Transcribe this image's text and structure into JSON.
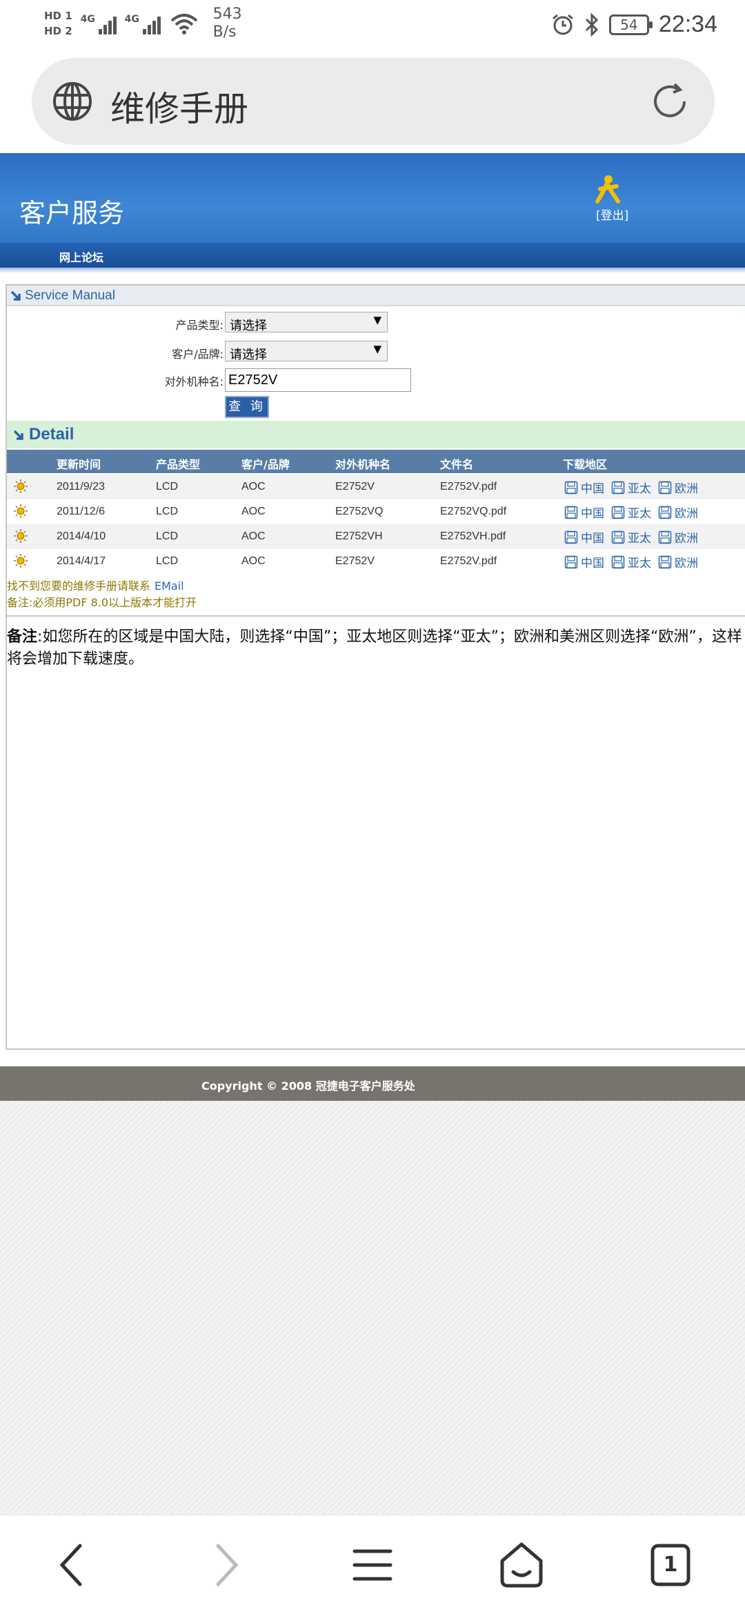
{
  "status_bar": {
    "sim1": "HD 1",
    "sim2": "HD 2",
    "net1": "4G",
    "net2": "4G",
    "speed_value": "543",
    "speed_unit": "B/s",
    "battery": "54",
    "time": "22:34"
  },
  "browser": {
    "page_title": "维修手册"
  },
  "site": {
    "title": "客户服务",
    "logout": "[登出]",
    "nav_forum": "网上论坛"
  },
  "search": {
    "section_title": "Service Manual",
    "product_type_label": "产品类型:",
    "product_type_value": "请选择",
    "brand_label": "客户/品牌:",
    "brand_value": "请选择",
    "model_label": "对外机种名:",
    "model_value": "E2752V",
    "query_button": "查 询"
  },
  "detail": {
    "section_title": "Detail",
    "columns": [
      "更新时间",
      "产品类型",
      "客户/品牌",
      "对外机种名",
      "文件名",
      "下载地区"
    ],
    "rows": [
      {
        "date": "2011/9/23",
        "type": "LCD",
        "brand": "AOC",
        "model": "E2752V",
        "file": "E2752V.pdf"
      },
      {
        "date": "2011/12/6",
        "type": "LCD",
        "brand": "AOC",
        "model": "E2752VQ",
        "file": "E2752VQ.pdf"
      },
      {
        "date": "2014/4/10",
        "type": "LCD",
        "brand": "AOC",
        "model": "E2752VH",
        "file": "E2752VH.pdf"
      },
      {
        "date": "2014/4/17",
        "type": "LCD",
        "brand": "AOC",
        "model": "E2752V",
        "file": "E2752V.pdf"
      }
    ],
    "regions": [
      "中国",
      "亚太",
      "欧洲"
    ]
  },
  "notes": {
    "not_found": "找不到您要的维修手册请联系",
    "email": "EMail",
    "pdf_note": "备注:必须用PDF 8.0以上版本才能打开",
    "remark_label": "备注",
    "remark_text": ":如您所在的区域是中国大陆，则选择“中国”；亚太地区则选择“亚太”；欧洲和美洲区则选择“欧洲”，这样将会增加下载速度。"
  },
  "footer": {
    "copyright": "Copyright © 2008 冠捷电子客户服务处"
  },
  "bottom_nav": {
    "tab_count": "1"
  },
  "colors": {
    "header_blue": "#3f86d6",
    "nav_dark_blue": "#1a4e94",
    "table_header": "#587ea8",
    "link_blue": "#2a64a8",
    "note_olive": "#8a7a00",
    "footer_gray": "#76746c"
  },
  "icons": {
    "globe": "globe-icon",
    "reload": "reload-icon",
    "aim": "aim-person-icon",
    "section_arrow": "arrow-down-right-icon",
    "row_marker": "sun-icon",
    "download": "floppy-disk-icon"
  }
}
